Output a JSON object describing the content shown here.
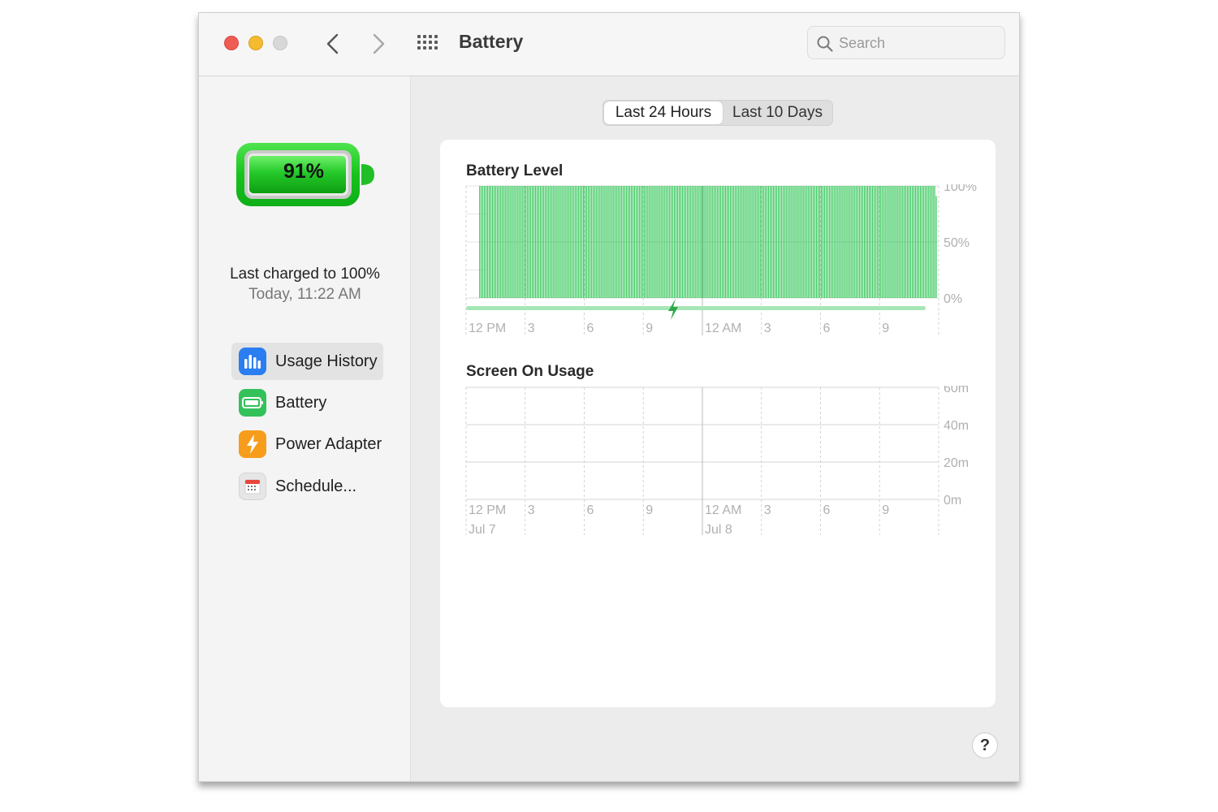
{
  "window": {
    "title": "Battery"
  },
  "search": {
    "placeholder": "Search"
  },
  "status": {
    "percent_label": "91%",
    "level": 0.91,
    "last_charged": "Last charged to 100%",
    "last_charged_time": "Today, 11:22 AM"
  },
  "sidebar": {
    "items": [
      {
        "label": "Usage History",
        "icon": "usage-history-icon",
        "color": "#2a7ef2",
        "selected": true
      },
      {
        "label": "Battery",
        "icon": "battery-icon",
        "color": "#34c15a",
        "selected": false
      },
      {
        "label": "Power Adapter",
        "icon": "power-adapter-icon",
        "color": "#f79d1c",
        "selected": false
      },
      {
        "label": "Schedule...",
        "icon": "schedule-icon",
        "color": "#e6e6e6",
        "selected": false
      }
    ]
  },
  "tabs": {
    "active": "Last 24 Hours",
    "other": "Last 10 Days"
  },
  "colors": {
    "battery_green": "#34c759",
    "charging_bar": "#a6e6b6",
    "grid": "#d9d9d9"
  },
  "chart_data": [
    {
      "type": "bar",
      "title": "Battery Level",
      "x_tick_labels": [
        "12 PM",
        "3",
        "6",
        "9",
        "12 AM",
        "3",
        "6",
        "9"
      ],
      "y_tick_labels": [
        "100%",
        "50%",
        "0%"
      ],
      "ylim": [
        0,
        100
      ],
      "series": [
        {
          "values": [
            0,
            0,
            0,
            0,
            0,
            0,
            0,
            0,
            100,
            100,
            100,
            100,
            100,
            100,
            100,
            100,
            100,
            100,
            100,
            100,
            100,
            100,
            100,
            100,
            100,
            100,
            100,
            100,
            100,
            100,
            100,
            100,
            100,
            100,
            100,
            100,
            100,
            100,
            100,
            100,
            100,
            100,
            100,
            100,
            100,
            100,
            100,
            100,
            100,
            100,
            100,
            100,
            100,
            100,
            100,
            100,
            100,
            100,
            100,
            100,
            100,
            100,
            100,
            100,
            100,
            100,
            100,
            100,
            100,
            100,
            100,
            100,
            100,
            100,
            100,
            100,
            100,
            100,
            100,
            100,
            100,
            100,
            100,
            100,
            100,
            100,
            100,
            100,
            100,
            100,
            100,
            100,
            100,
            100,
            100,
            100,
            100,
            100,
            100,
            100,
            100,
            100,
            100,
            100,
            100,
            100,
            100,
            100,
            100,
            100,
            100,
            100,
            100,
            100,
            100,
            100,
            100,
            100,
            100,
            100,
            100,
            100,
            100,
            100,
            100,
            100,
            100,
            100,
            100,
            100,
            100,
            100,
            100,
            100,
            100,
            100,
            100,
            100,
            100,
            100,
            100,
            100,
            100,
            100,
            100,
            100,
            100,
            100,
            100,
            100,
            100,
            100,
            100,
            100,
            100,
            100,
            100,
            100,
            100,
            100,
            100,
            100,
            100,
            100,
            100,
            100,
            100,
            100,
            100,
            100,
            100,
            100,
            100,
            100,
            100,
            100,
            100,
            100,
            100,
            100,
            100,
            100,
            100,
            100,
            100,
            100,
            100,
            100,
            100,
            100,
            100,
            100,
            100,
            100,
            100,
            100,
            100,
            100,
            100,
            100,
            100,
            100,
            100,
            100,
            100,
            100,
            100,
            100,
            100,
            100,
            100,
            100,
            100,
            100,
            100,
            100,
            100,
            100,
            100,
            100,
            100,
            100,
            100,
            100,
            100,
            100,
            100,
            100,
            100,
            100,
            100,
            100,
            100,
            100,
            100,
            100,
            100,
            100,
            100,
            100,
            100,
            100,
            100,
            100,
            100,
            100,
            100,
            100,
            100,
            100,
            100,
            100,
            100,
            100,
            100,
            100,
            100,
            100,
            100,
            100,
            100,
            100,
            100,
            100,
            100,
            100,
            100,
            100,
            100,
            100,
            100,
            100,
            100,
            100,
            100,
            100,
            100,
            100,
            100,
            100,
            100,
            100,
            100,
            100,
            100,
            100,
            100,
            100,
            100,
            100,
            100,
            100,
            100,
            100,
            91,
            0
          ]
        }
      ],
      "charging": {
        "start": 0,
        "end": 24,
        "charged_at": "11:22 AM"
      }
    },
    {
      "type": "bar",
      "title": "Screen On Usage",
      "x_tick_labels": [
        "12 PM",
        "3",
        "6",
        "9",
        "12 AM",
        "3",
        "6",
        "9"
      ],
      "x_date_labels": [
        "Jul 7",
        "Jul 8"
      ],
      "y_tick_labels": [
        "60m",
        "40m",
        "20m",
        "0m"
      ],
      "ylim": [
        0,
        60
      ],
      "series": [
        {
          "values": []
        }
      ]
    }
  ]
}
